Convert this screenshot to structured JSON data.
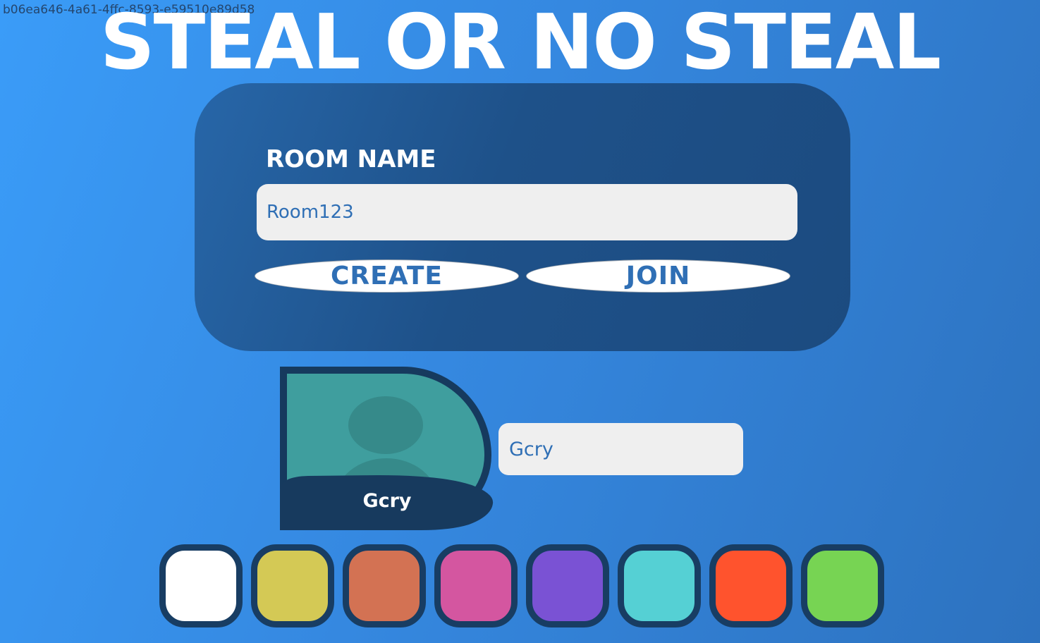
{
  "session": {
    "id": "b06ea646-4a61-4ffc-8593-e59510e89d58"
  },
  "title": "STEAL OR NO STEAL",
  "room": {
    "label": "ROOM NAME",
    "value": "Room123",
    "create_label": "CREATE",
    "join_label": "JOIN"
  },
  "player": {
    "avatar_icon": "person-silhouette",
    "avatar_color": "#3f9e9e",
    "display_name": "Gcry",
    "name_input_value": "Gcry"
  },
  "colors": [
    {
      "name": "white",
      "hex": "#ffffff"
    },
    {
      "name": "yellow",
      "hex": "#d4c955"
    },
    {
      "name": "orange",
      "hex": "#d37253"
    },
    {
      "name": "pink",
      "hex": "#d456a0"
    },
    {
      "name": "purple",
      "hex": "#7a52d4"
    },
    {
      "name": "teal",
      "hex": "#55d0d4"
    },
    {
      "name": "red",
      "hex": "#ff532d"
    },
    {
      "name": "green",
      "hex": "#77d453"
    }
  ]
}
